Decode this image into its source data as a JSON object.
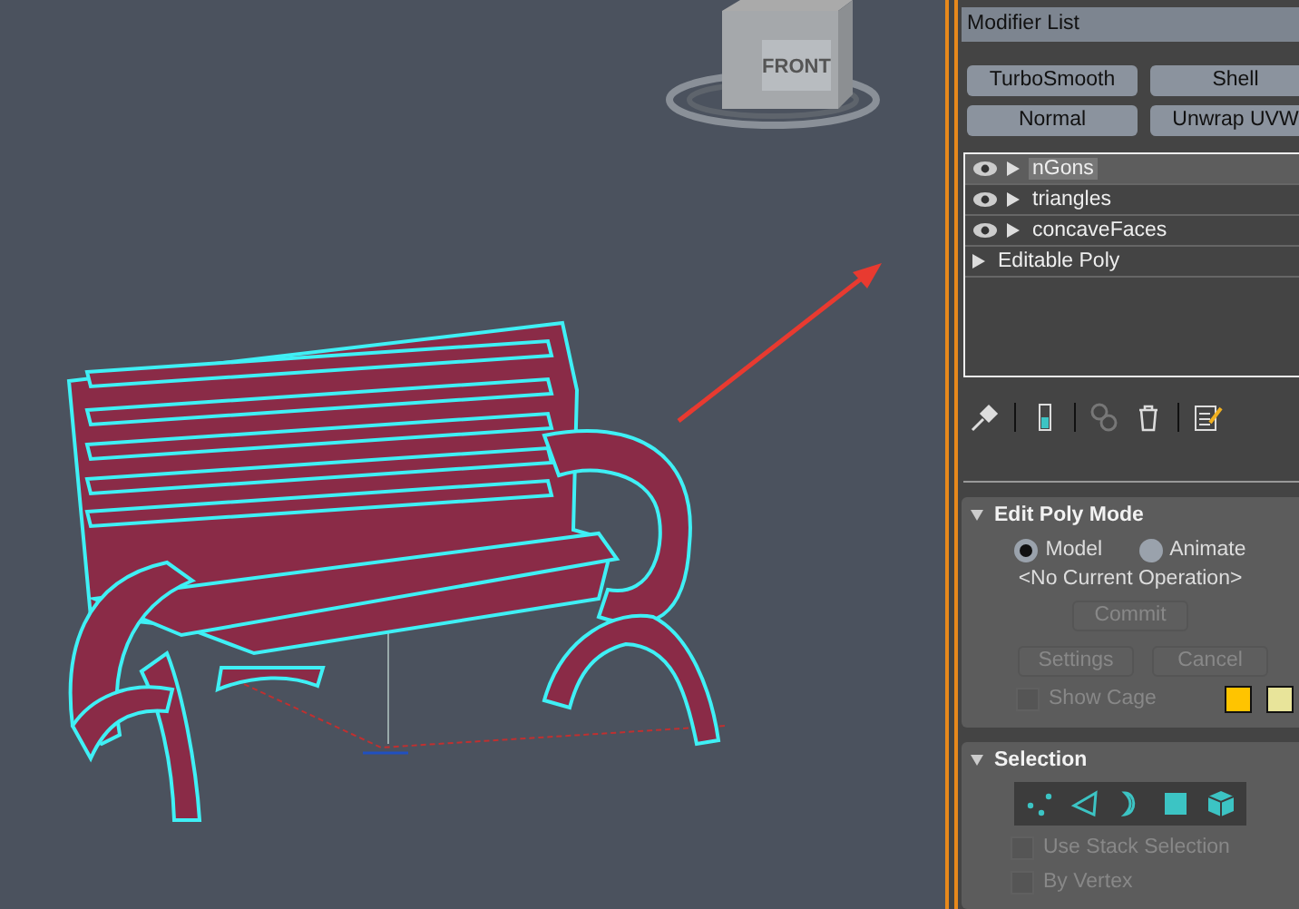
{
  "viewport": {
    "viewcube": {
      "face_label": "FRONT"
    }
  },
  "command_panel": {
    "modifier_list": {
      "label": "Modifier List"
    },
    "modifier_buttons": [
      {
        "label": "TurboSmooth"
      },
      {
        "label": "Shell"
      },
      {
        "label": "Normal"
      },
      {
        "label": "Unwrap UVW"
      }
    ],
    "modifier_stack": [
      {
        "kind": "modifier",
        "label": "nGons",
        "selected": true
      },
      {
        "kind": "modifier",
        "label": "triangles",
        "selected": false
      },
      {
        "kind": "modifier",
        "label": "concaveFaces",
        "selected": false
      },
      {
        "kind": "base",
        "label": "Editable Poly",
        "selected": false
      }
    ],
    "edit_poly_mode": {
      "title": "Edit Poly Mode",
      "expanded": true,
      "modes": [
        {
          "label": "Model",
          "selected": true
        },
        {
          "label": "Animate",
          "selected": false
        }
      ],
      "operation": "<No Current Operation>",
      "commit": {
        "label": "Commit",
        "disabled": true
      },
      "buttons": [
        {
          "label": "Settings",
          "disabled": true
        },
        {
          "label": "Cancel",
          "disabled": true
        }
      ],
      "show_cage": {
        "label": "Show Cage",
        "checked": false,
        "disabled": true
      },
      "cage_colors": [
        {
          "color": "#ffc400"
        },
        {
          "color": "#e8e49a"
        }
      ]
    },
    "selection": {
      "title": "Selection",
      "expanded": true,
      "levels": [
        {
          "kind": "vertex"
        },
        {
          "kind": "edge"
        },
        {
          "kind": "border"
        },
        {
          "kind": "polygon"
        },
        {
          "kind": "element"
        }
      ],
      "options": [
        {
          "label": "Use Stack Selection",
          "checked": false,
          "disabled": true
        },
        {
          "label": "By Vertex",
          "checked": false,
          "disabled": true
        }
      ]
    }
  }
}
